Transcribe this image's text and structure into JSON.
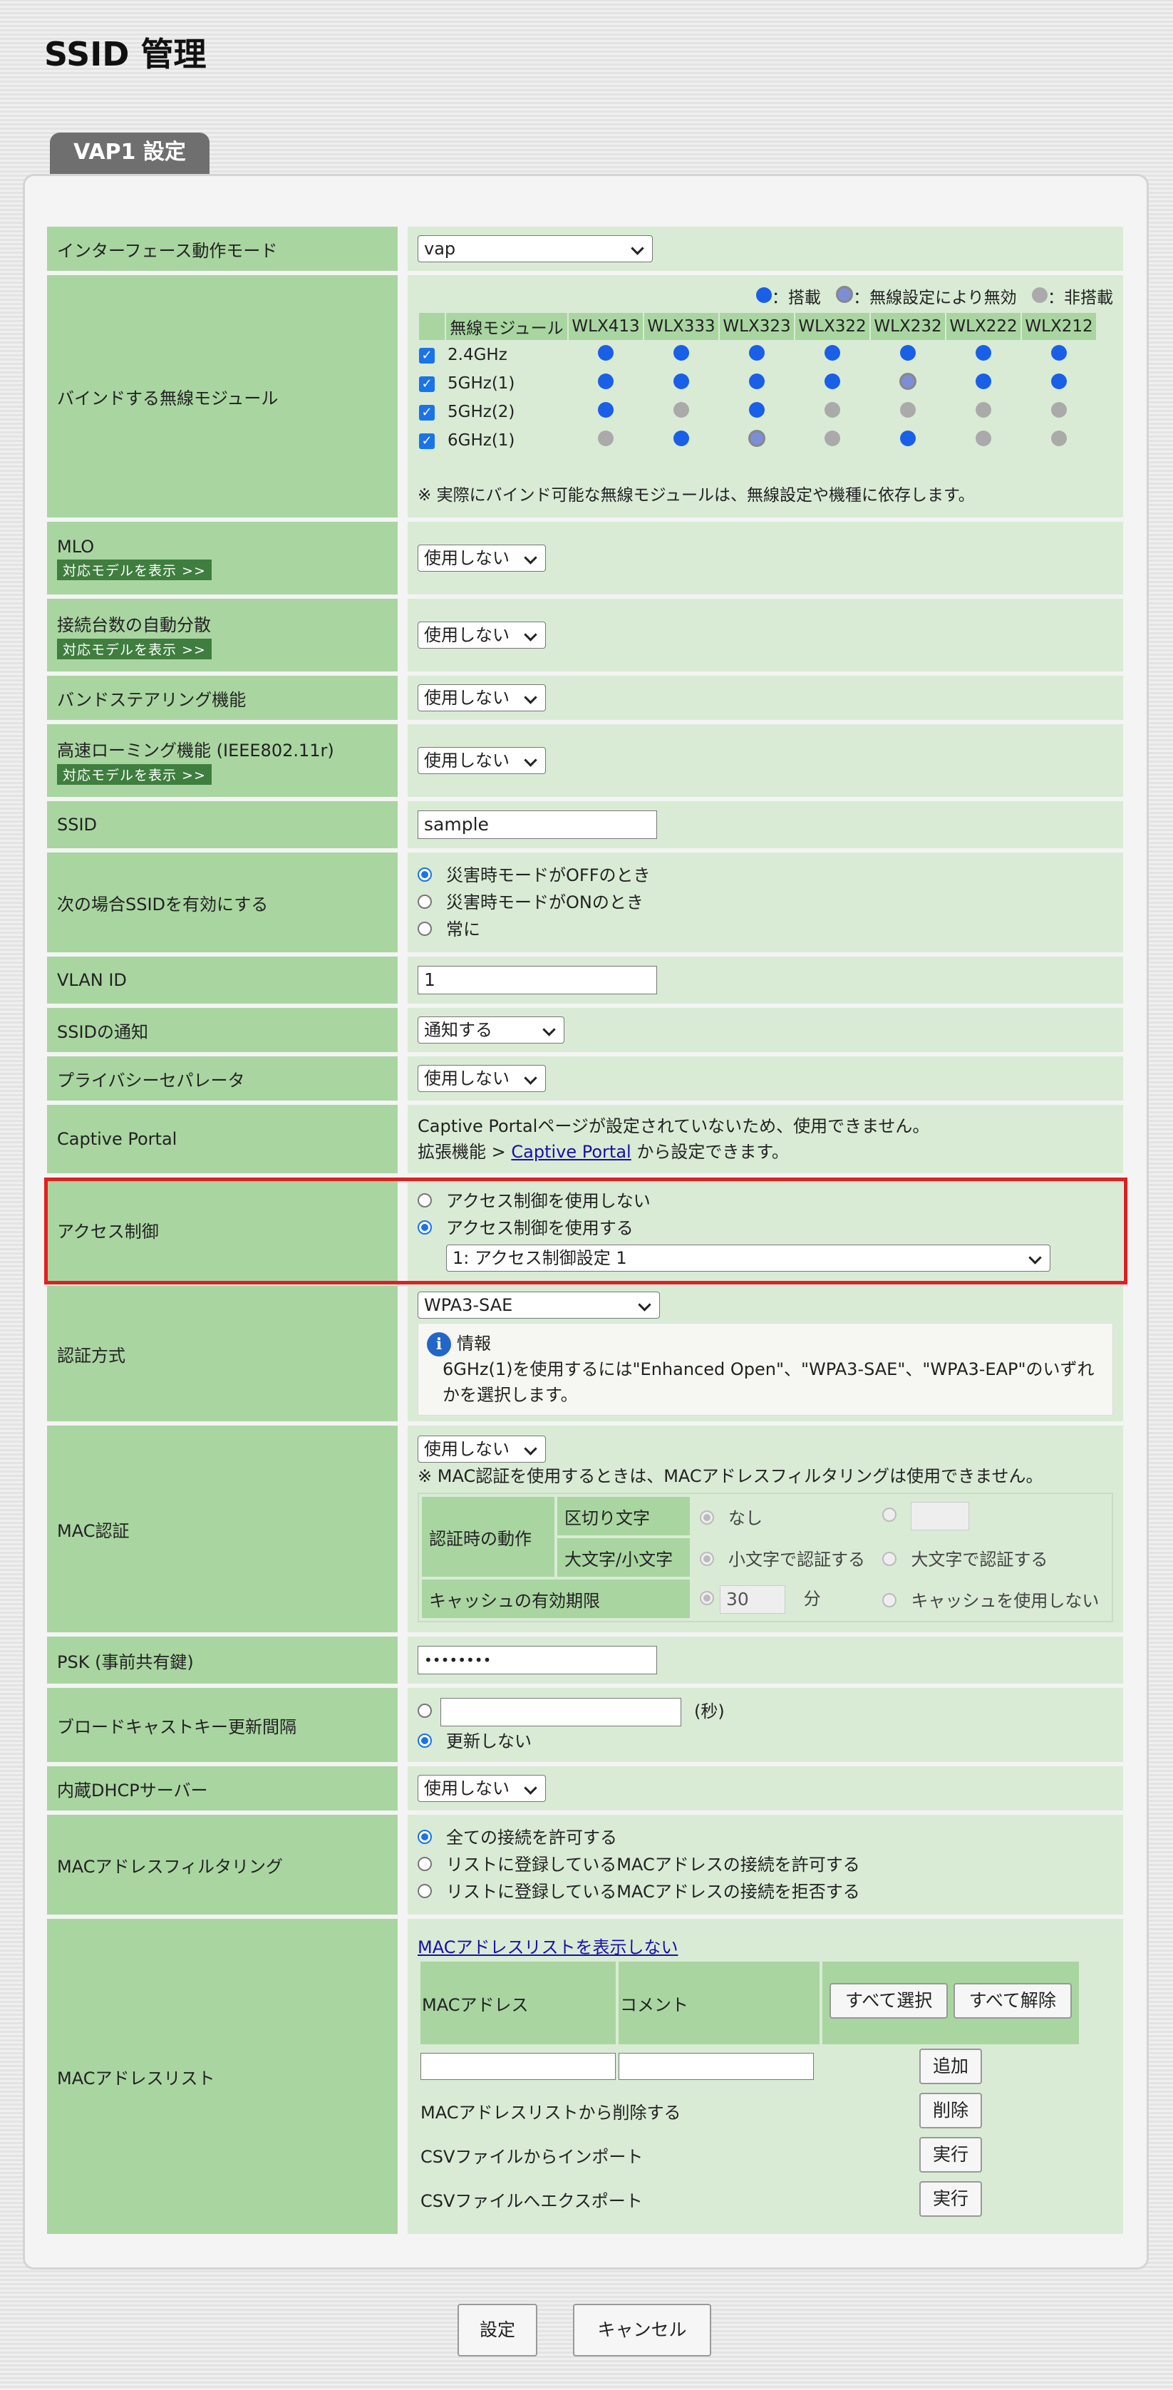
{
  "page_title": "SSID 管理",
  "tab_label": "VAP1 設定",
  "rows": {
    "interface_mode": {
      "label": "インターフェース動作モード",
      "value": "vap"
    },
    "bind_module": {
      "label": "バインドする無線モジュール",
      "legend": {
        "on": "：搭載",
        "disabled": "：無線設定により無効",
        "none": "：非搭載"
      },
      "header": [
        "無線モジュール",
        "WLX413",
        "WLX333",
        "WLX323",
        "WLX322",
        "WLX232",
        "WLX222",
        "WLX212"
      ],
      "modules": [
        {
          "name": "2.4GHz",
          "cells": [
            "on",
            "on",
            "on",
            "on",
            "on",
            "on",
            "on"
          ]
        },
        {
          "name": "5GHz(1)",
          "cells": [
            "on",
            "on",
            "on",
            "on",
            "disabled",
            "on",
            "on"
          ]
        },
        {
          "name": "5GHz(2)",
          "cells": [
            "on",
            "none",
            "on",
            "none",
            "none",
            "none",
            "none"
          ]
        },
        {
          "name": "6GHz(1)",
          "cells": [
            "none",
            "on",
            "disabled",
            "none",
            "on",
            "none",
            "none"
          ]
        }
      ],
      "note": "※ 実際にバインド可能な無線モジュールは、無線設定や機種に依存します。"
    },
    "mlo": {
      "label": "MLO",
      "tag": "対応モデルを表示 >>",
      "value": "使用しない"
    },
    "auto_dist": {
      "label": "接続台数の自動分散",
      "tag": "対応モデルを表示 >>",
      "value": "使用しない"
    },
    "band_steering": {
      "label": "バンドステアリング機能",
      "value": "使用しない"
    },
    "fast_roaming": {
      "label": "高速ローミング機能 (IEEE802.11r)",
      "tag": "対応モデルを表示 >>",
      "value": "使用しない"
    },
    "ssid": {
      "label": "SSID",
      "value": "sample"
    },
    "ssid_enable": {
      "label": "次の場合SSIDを有効にする",
      "options": [
        "災害時モードがOFFのとき",
        "災害時モードがONのとき",
        "常に"
      ]
    },
    "vlan": {
      "label": "VLAN ID",
      "value": "1"
    },
    "ssid_notify": {
      "label": "SSIDの通知",
      "value": "通知する"
    },
    "privacy": {
      "label": "プライバシーセパレータ",
      "value": "使用しない"
    },
    "captive": {
      "label": "Captive Portal",
      "line1": "Captive Portalページが設定されていないため、使用できません。",
      "line2a": "拡張機能 > ",
      "link": "Captive Portal",
      "line2b": " から設定できます。"
    },
    "access": {
      "label": "アクセス制御",
      "options": [
        "アクセス制御を使用しない",
        "アクセス制御を使用する"
      ],
      "select": "1: アクセス制御設定 1"
    },
    "auth": {
      "label": "認証方式",
      "value": "WPA3-SAE",
      "info_title": "情報",
      "info_text": "6GHz(1)を使用するには\"Enhanced Open\"、\"WPA3-SAE\"、\"WPA3-EAP\"のいずれかを選択します。"
    },
    "mac_auth": {
      "label": "MAC認証",
      "value": "使用しない",
      "note": "※ MAC認証を使用するときは、MACアドレスフィルタリングは使用できません。",
      "auth_action": "認証時の動作",
      "delimiter": "区切り文字",
      "none": "なし",
      "case": "大文字/小文字",
      "lower": "小文字で認証する",
      "upper": "大文字で認証する",
      "cache": "キャッシュの有効期限",
      "cache_val": "30",
      "minutes": "分",
      "no_cache": "キャッシュを使用しない"
    },
    "psk": {
      "label": "PSK (事前共有鍵)",
      "value": "••••••••"
    },
    "broadcast_key": {
      "label": "ブロードキャストキー更新間隔",
      "unit": "(秒)",
      "no_update": "更新しない"
    },
    "dhcp": {
      "label": "内蔵DHCPサーバー",
      "value": "使用しない"
    },
    "mac_filter": {
      "label": "MACアドレスフィルタリング",
      "options": [
        "全ての接続を許可する",
        "リストに登録しているMACアドレスの接続を許可する",
        "リストに登録しているMACアドレスの接続を拒否する"
      ]
    },
    "mac_list": {
      "label": "MACアドレスリスト",
      "hide_link": "MACアドレスリストを表示しない",
      "col_mac": "MACアドレス",
      "col_comment": "コメント",
      "select_all": "すべて選択",
      "deselect_all": "すべて解除",
      "add": "追加",
      "delete_label": "MACアドレスリストから削除する",
      "delete": "削除",
      "import_label": "CSVファイルからインポート",
      "import": "実行",
      "export_label": "CSVファイルへエクスポート",
      "export": "実行"
    }
  },
  "buttons": {
    "submit": "設定",
    "cancel": "キャンセル"
  }
}
